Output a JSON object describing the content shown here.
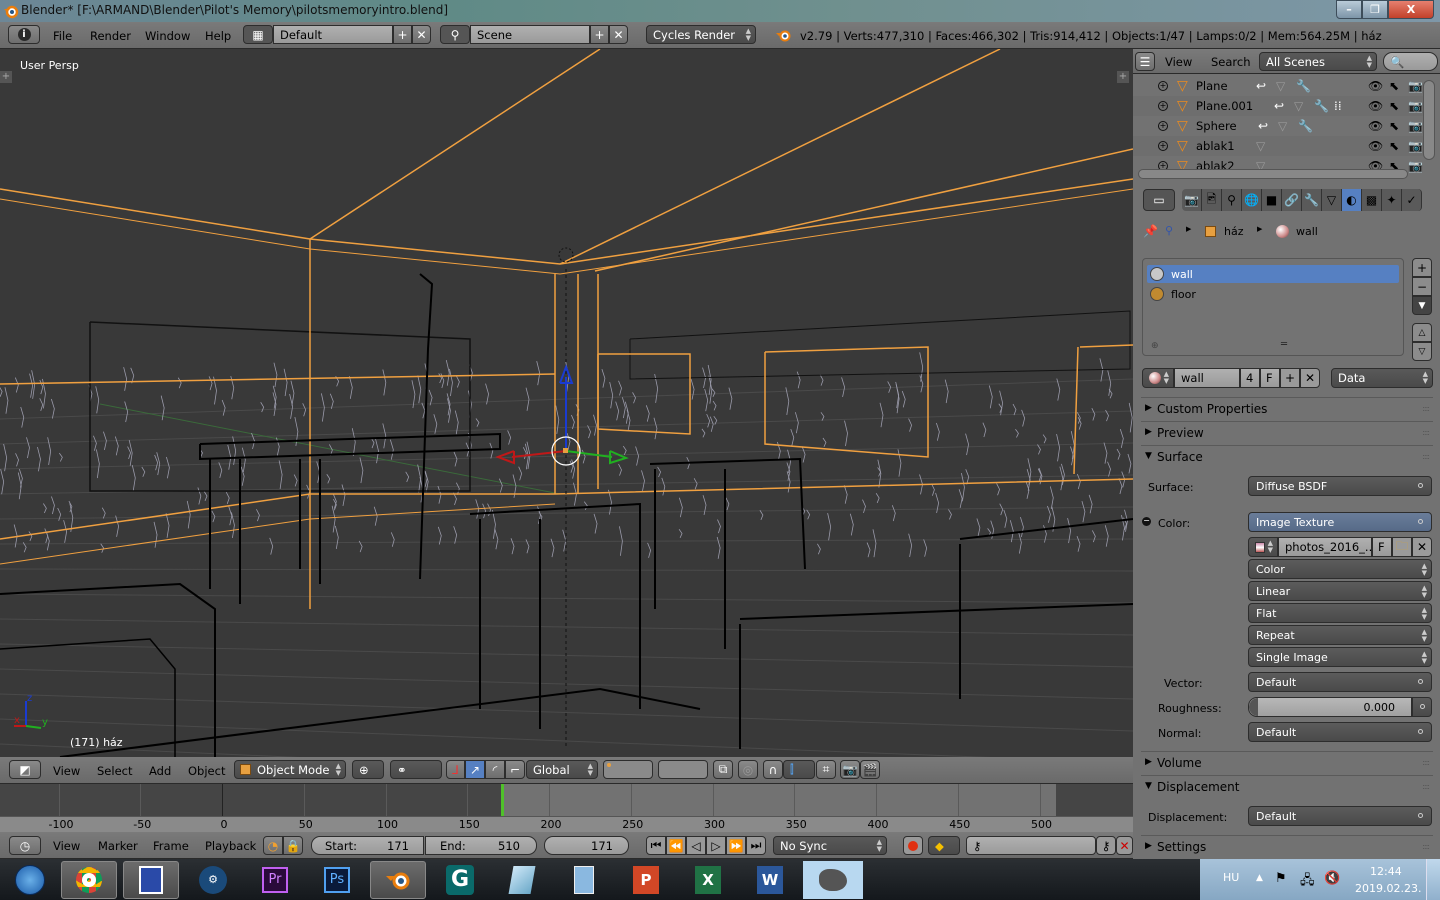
{
  "window": {
    "title": "Blender* [F:\\ARMAND\\Blender\\Pilot's Memory\\pilotsmemoryintro.blend]",
    "controls": {
      "minimize": "–",
      "maximize": "❐",
      "close": "X"
    }
  },
  "info_header": {
    "menus": [
      "File",
      "Render",
      "Window",
      "Help"
    ],
    "layout": "Default",
    "scene": "Scene",
    "engine": "Cycles Render",
    "stats": "v2.79 | Verts:477,310 | Faces:466,302 | Tris:914,412 | Objects:1/47 | Lamps:0/2 | Mem:564.25M | ház"
  },
  "viewport": {
    "view_name": "User Persp",
    "object_info": "(171) ház",
    "axes": {
      "x": "x",
      "y": "y",
      "z": "z"
    },
    "colors": {
      "selected_wire": "#f0a040",
      "wire": "#000000",
      "grass": "#9a9aaa",
      "background": "#393939"
    }
  },
  "view3d_header": {
    "menus": [
      "View",
      "Select",
      "Add",
      "Object"
    ],
    "mode": "Object Mode",
    "orientation": "Global"
  },
  "timeline": {
    "ticks": [
      "-100",
      "-50",
      "0",
      "50",
      "100",
      "150",
      "200",
      "250",
      "300",
      "350",
      "400",
      "450",
      "500"
    ],
    "current_frame_marker_color": "#4fc12a",
    "menus": [
      "View",
      "Marker",
      "Frame",
      "Playback"
    ],
    "start_label": "Start:",
    "start": "171",
    "end_label": "End:",
    "end": "510",
    "current": "171",
    "sync": "No Sync"
  },
  "outliner": {
    "menus": [
      "View",
      "Search"
    ],
    "filter": "All Scenes",
    "items": [
      {
        "name": "Plane"
      },
      {
        "name": "Plane.001"
      },
      {
        "name": "Sphere"
      },
      {
        "name": "ablak1"
      },
      {
        "name": "ablak2"
      }
    ]
  },
  "properties": {
    "tabs": [
      "render-icon",
      "render-layers-icon",
      "scene-icon",
      "world-icon",
      "object-icon",
      "constraints-icon",
      "modifiers-icon",
      "data-icon",
      "material-icon",
      "texture-icon",
      "particles-icon",
      "physics-icon"
    ],
    "active_tab": "material-icon",
    "breadcrumb": [
      "ház",
      "wall"
    ],
    "material_slots": [
      {
        "name": "wall",
        "color": "#c8c8c8",
        "selected": true
      },
      {
        "name": "floor",
        "color": "#c08a30",
        "selected": false
      }
    ],
    "datablock": {
      "name": "wall",
      "users": "4",
      "fake": "F",
      "link": "Data"
    },
    "panels": {
      "custom_properties": "Custom Properties",
      "preview": "Preview",
      "surface": "Surface",
      "volume": "Volume",
      "displacement": "Displacement",
      "settings": "Settings"
    },
    "surface": {
      "surface_label": "Surface:",
      "surface_value": "Diffuse BSDF",
      "color_label": "Color:",
      "color_value": "Image Texture",
      "image_name": "photos_2016_...",
      "image_fake": "F",
      "color_space": "Color",
      "interpolation": "Linear",
      "projection": "Flat",
      "extension": "Repeat",
      "source": "Single Image",
      "vector_label": "Vector:",
      "vector_value": "Default",
      "roughness_label": "Roughness:",
      "roughness_value": "0.000",
      "normal_label": "Normal:",
      "normal_value": "Default"
    },
    "displacement": {
      "label": "Displacement:",
      "value": "Default"
    }
  },
  "taskbar": {
    "apps": [
      "start",
      "chrome",
      "save",
      "steam",
      "Pr",
      "Ps",
      "blender",
      "G",
      "notepad",
      "calculator",
      "P",
      "X",
      "W",
      "gimp"
    ],
    "language": "HU",
    "time": "12:44",
    "date": "2019.02.23."
  }
}
